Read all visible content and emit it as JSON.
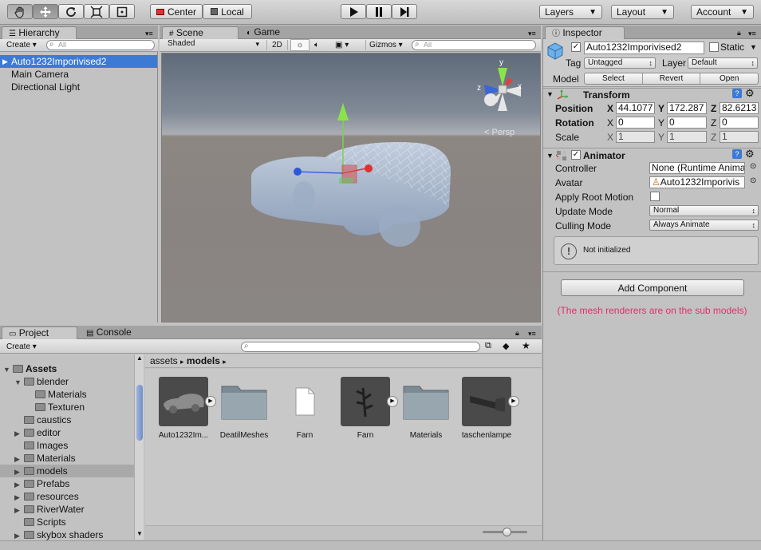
{
  "toolbar": {
    "tools": [
      "hand-icon",
      "move-icon",
      "rotate-icon",
      "scale-icon",
      "rect-icon"
    ],
    "pivot": "Center",
    "space": "Local",
    "layers": "Layers",
    "layout": "Layout",
    "account": "Account"
  },
  "hierarchy": {
    "tab": "Hierarchy",
    "create": "Create",
    "search_placeholder": "All",
    "items": [
      "Auto1232Imporivised2",
      "Main Camera",
      "Directional Light"
    ]
  },
  "scene": {
    "tab_scene": "Scene",
    "tab_game": "Game",
    "shading": "Shaded",
    "mode2d": "2D",
    "gizmos": "Gizmos",
    "search_placeholder": "All",
    "persp": "Persp",
    "axis_y": "y",
    "axis_x": "x",
    "axis_z": "z"
  },
  "inspector": {
    "tab": "Inspector",
    "object_name": "Auto1232Imporivised2",
    "static": "Static",
    "tag_label": "Tag",
    "tag": "Untagged",
    "layer_label": "Layer",
    "layer": "Default",
    "model_label": "Model",
    "model_select": "Select",
    "model_revert": "Revert",
    "model_open": "Open",
    "transform": {
      "title": "Transform",
      "position_label": "Position",
      "rotation_label": "Rotation",
      "scale_label": "Scale",
      "x": "X",
      "y": "Y",
      "z": "Z",
      "position": [
        "44.1077",
        "172.287",
        "82.6213"
      ],
      "rotation": [
        "0",
        "0",
        "0"
      ],
      "scale": [
        "1",
        "1",
        "1"
      ]
    },
    "animator": {
      "title": "Animator",
      "controller_label": "Controller",
      "controller": "None (Runtime Anima",
      "avatar_label": "Avatar",
      "avatar": "Auto1232Imporivis",
      "apply_root_label": "Apply Root Motion",
      "update_label": "Update Mode",
      "update": "Normal",
      "culling_label": "Culling Mode",
      "culling": "Always Animate",
      "status": "Not initialized"
    },
    "add_component": "Add Component",
    "note": "(The mesh renderers are on the sub models)",
    "note_color": "#e0306a"
  },
  "project": {
    "tab_project": "Project",
    "tab_console": "Console",
    "create": "Create",
    "tree": [
      {
        "label": "Assets",
        "depth": 0,
        "arrow": "▼",
        "bold": true
      },
      {
        "label": "blender",
        "depth": 1,
        "arrow": "▼"
      },
      {
        "label": "Materials",
        "depth": 2,
        "arrow": ""
      },
      {
        "label": "Texturen",
        "depth": 2,
        "arrow": ""
      },
      {
        "label": "caustics",
        "depth": 1,
        "arrow": ""
      },
      {
        "label": "editor",
        "depth": 1,
        "arrow": "▶"
      },
      {
        "label": "Images",
        "depth": 1,
        "arrow": ""
      },
      {
        "label": "Materials",
        "depth": 1,
        "arrow": "▶"
      },
      {
        "label": "models",
        "depth": 1,
        "arrow": "▶",
        "selected": true
      },
      {
        "label": "Prefabs",
        "depth": 1,
        "arrow": "▶"
      },
      {
        "label": "resources",
        "depth": 1,
        "arrow": "▶"
      },
      {
        "label": "RiverWater",
        "depth": 1,
        "arrow": "▶"
      },
      {
        "label": "Scripts",
        "depth": 1,
        "arrow": ""
      },
      {
        "label": "skybox shaders",
        "depth": 1,
        "arrow": "▶"
      }
    ],
    "breadcrumb": [
      "assets",
      "models"
    ],
    "assets": [
      {
        "label": "Auto1232Im...",
        "kind": "model-car"
      },
      {
        "label": "DeatilMeshes",
        "kind": "folder"
      },
      {
        "label": "Farn",
        "kind": "file"
      },
      {
        "label": "Farn",
        "kind": "model-fern"
      },
      {
        "label": "Materials",
        "kind": "folder"
      },
      {
        "label": "taschenlampe",
        "kind": "model-torch"
      }
    ],
    "zoom_slider": 0.55
  }
}
